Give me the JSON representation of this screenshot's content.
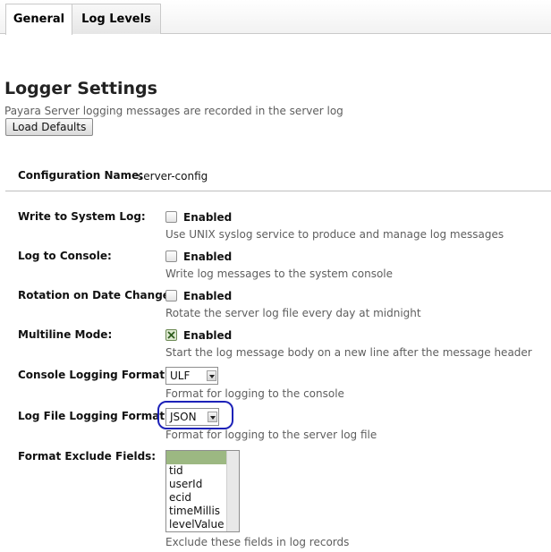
{
  "tabs": [
    {
      "label": "General",
      "active": true
    },
    {
      "label": "Log Levels",
      "active": false
    }
  ],
  "page": {
    "title": "Logger Settings",
    "help": "Payara Server logging messages are recorded in the server log",
    "load_defaults_label": "Load Defaults"
  },
  "config": {
    "label": "Configuration Name:",
    "value": "server-config"
  },
  "fields": {
    "write_syslog": {
      "label": "Write to System Log:",
      "checkbox_label": "Enabled",
      "checked": false,
      "help": "Use UNIX syslog service to produce and manage log messages"
    },
    "log_console": {
      "label": "Log to Console:",
      "checkbox_label": "Enabled",
      "checked": false,
      "help": "Write log messages to the system console"
    },
    "rotation": {
      "label": "Rotation on Date Change:",
      "checkbox_label": "Enabled",
      "checked": false,
      "help": "Rotate the server log file every day at midnight"
    },
    "multiline": {
      "label": "Multiline Mode:",
      "checkbox_label": "Enabled",
      "checked": true,
      "help": "Start the log message body on a new line after the message header"
    },
    "console_format": {
      "label": "Console Logging Format:",
      "value": "ULF",
      "help": "Format for logging to the console"
    },
    "logfile_format": {
      "label": "Log File Logging Format:",
      "value": "JSON",
      "help": "Format for logging to the server log file"
    },
    "exclude_fields": {
      "label": "Format Exclude Fields:",
      "options": [
        "",
        "tid",
        "userId",
        "ecid",
        "timeMillis",
        "levelValue"
      ],
      "selected": "",
      "help": "Exclude these fields in log records"
    }
  },
  "colors": {
    "highlight_ring": "#1d22b8",
    "selected_option": "#9cb882"
  }
}
